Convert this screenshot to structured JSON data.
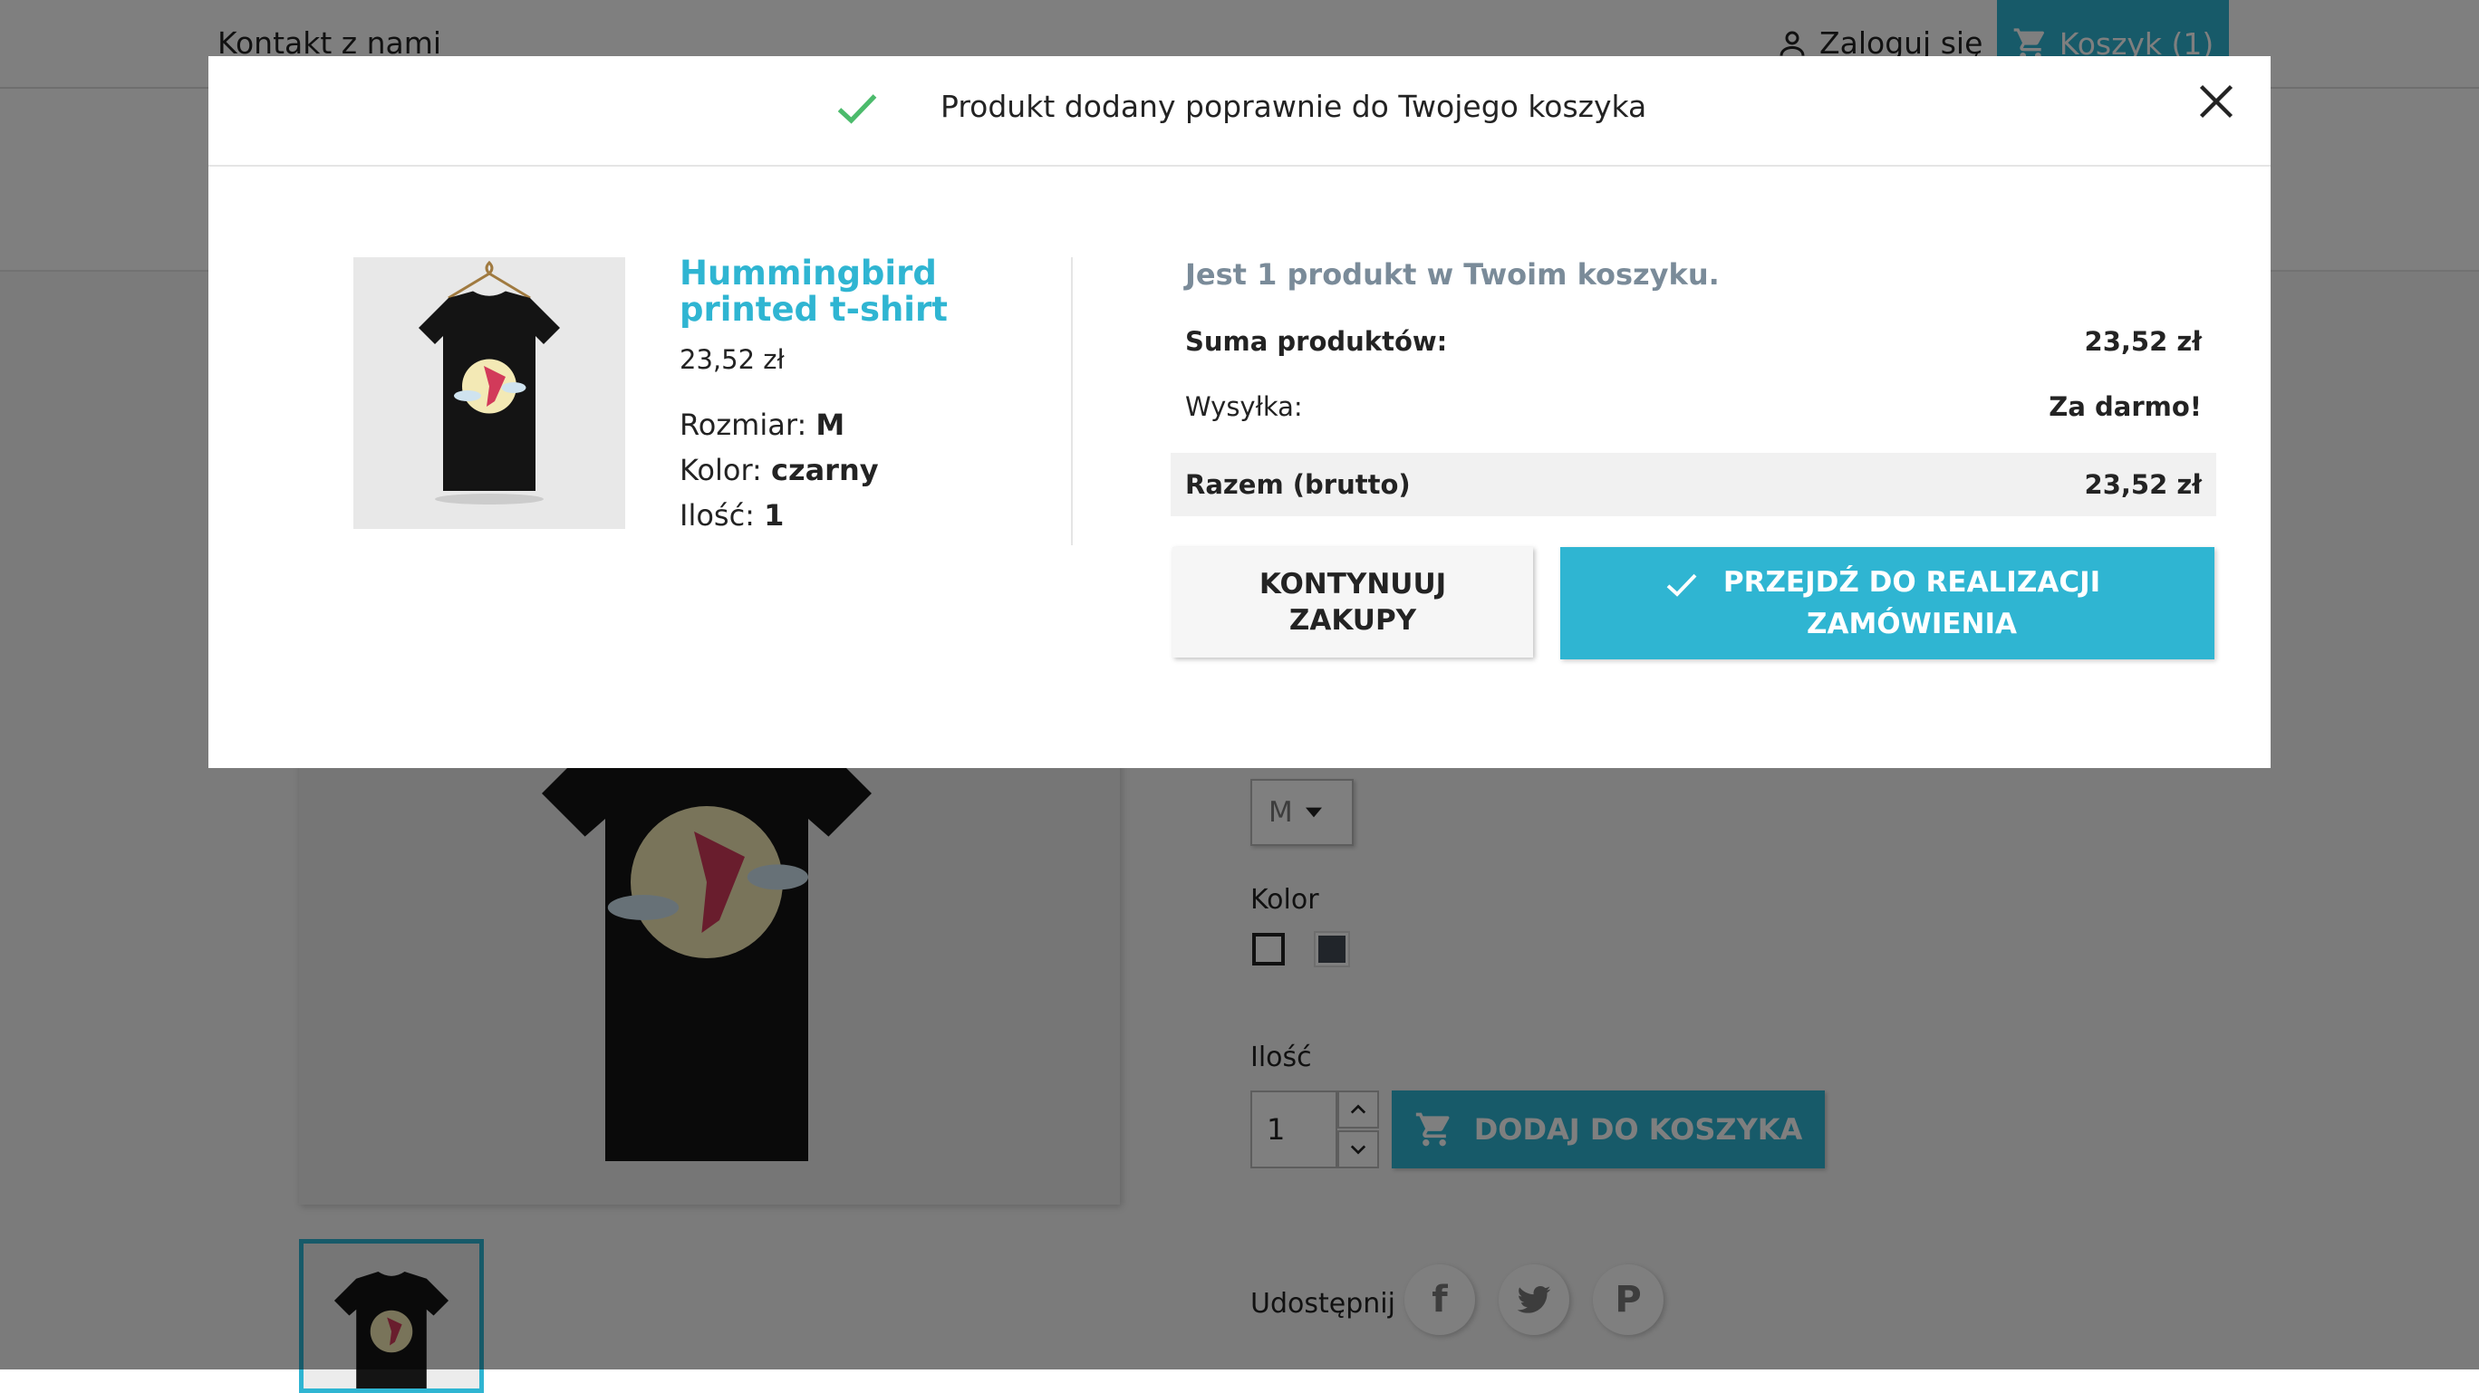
{
  "header": {
    "contact_label": "Kontakt z nami",
    "login_label": "Zaloguj się",
    "cart_label": "Koszyk (1)"
  },
  "product_page": {
    "size_value": "M",
    "color_label": "Kolor",
    "quantity_label": "Ilość",
    "quantity_value": "1",
    "add_to_cart_label": "DODAJ DO KOSZYKA",
    "share_label": "Udostępnij",
    "social": [
      "f",
      "twitter",
      "P"
    ]
  },
  "modal": {
    "title": "Produkt dodany poprawnie do Twojego koszyka",
    "product": {
      "name": "Hummingbird printed t-shirt",
      "price": "23,52 zł",
      "size_label": "Rozmiar:",
      "size_value": "M",
      "color_label": "Kolor:",
      "color_value": "czarny",
      "qty_label": "Ilość:",
      "qty_value": "1"
    },
    "cart_summary": {
      "count_text": "Jest 1 produkt w Twoim koszyku.",
      "subtotal_label": "Suma produktów:",
      "subtotal_value": "23,52 zł",
      "shipping_label": "Wysyłka:",
      "shipping_value": "Za darmo!",
      "total_label": "Razem (brutto)",
      "total_value": "23,52 zł"
    },
    "continue_label": "KONTYNUUJ ZAKUPY",
    "checkout_label": "PRZEJDŹ DO REALIZACJI ZAMÓWIENIA"
  },
  "colors": {
    "accent": "#2fb5d2",
    "success": "#4cbb6c"
  }
}
